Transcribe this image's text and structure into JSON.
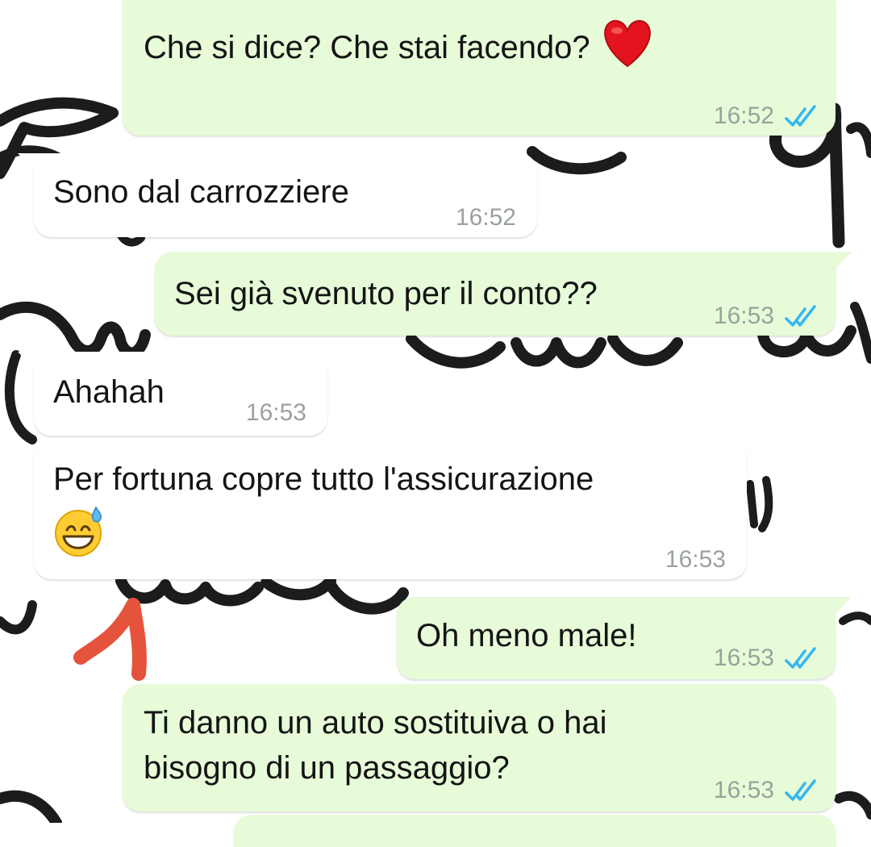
{
  "chat": {
    "messages": [
      {
        "id": "m1",
        "direction": "outgoing",
        "text": "Che si dice? Che stai facendo?",
        "emoji": "red-heart",
        "time": "16:52",
        "status": "read"
      },
      {
        "id": "m2",
        "direction": "incoming",
        "text": "Sono dal carrozziere",
        "time": "16:52"
      },
      {
        "id": "m3",
        "direction": "outgoing",
        "text": "Sei già svenuto per il conto??",
        "time": "16:53",
        "status": "read"
      },
      {
        "id": "m4",
        "direction": "incoming",
        "text": "Ahahah",
        "time": "16:53"
      },
      {
        "id": "m5",
        "direction": "incoming",
        "text": "Per fortuna copre tutto l'assicurazione",
        "emoji": "grinning-face-with-sweat",
        "time": "16:53"
      },
      {
        "id": "m6",
        "direction": "outgoing",
        "text": "Oh meno male!",
        "time": "16:53",
        "status": "read"
      },
      {
        "id": "m7",
        "direction": "outgoing",
        "text_lines": [
          "Ti danno un auto sostituiva o hai",
          "bisogno di un passaggio?"
        ],
        "time": "16:53",
        "status": "read"
      }
    ]
  },
  "colors": {
    "outgoing_bubble": "#e7fbd8",
    "incoming_bubble": "#ffffff",
    "timestamp": "#9aa29b",
    "read_ticks": "#34b7f1",
    "annotation_arrow": "#e5533c"
  }
}
